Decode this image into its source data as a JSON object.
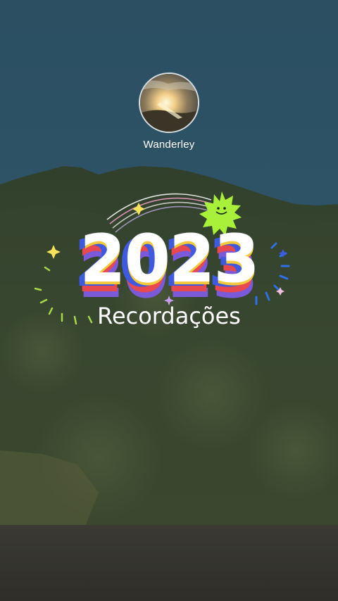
{
  "profile": {
    "user_name": "Wanderley",
    "avatar_icon": "sunset-photo"
  },
  "memory": {
    "year": "2023",
    "subtitle": "Recordações"
  },
  "colors": {
    "sky": "#2e5468",
    "mountain": "#3a4a32",
    "year_fill": "#ffffff",
    "year_blue": "#3d5ae0",
    "year_red": "#e8484f",
    "sun_sticker": "#a8f03a"
  }
}
